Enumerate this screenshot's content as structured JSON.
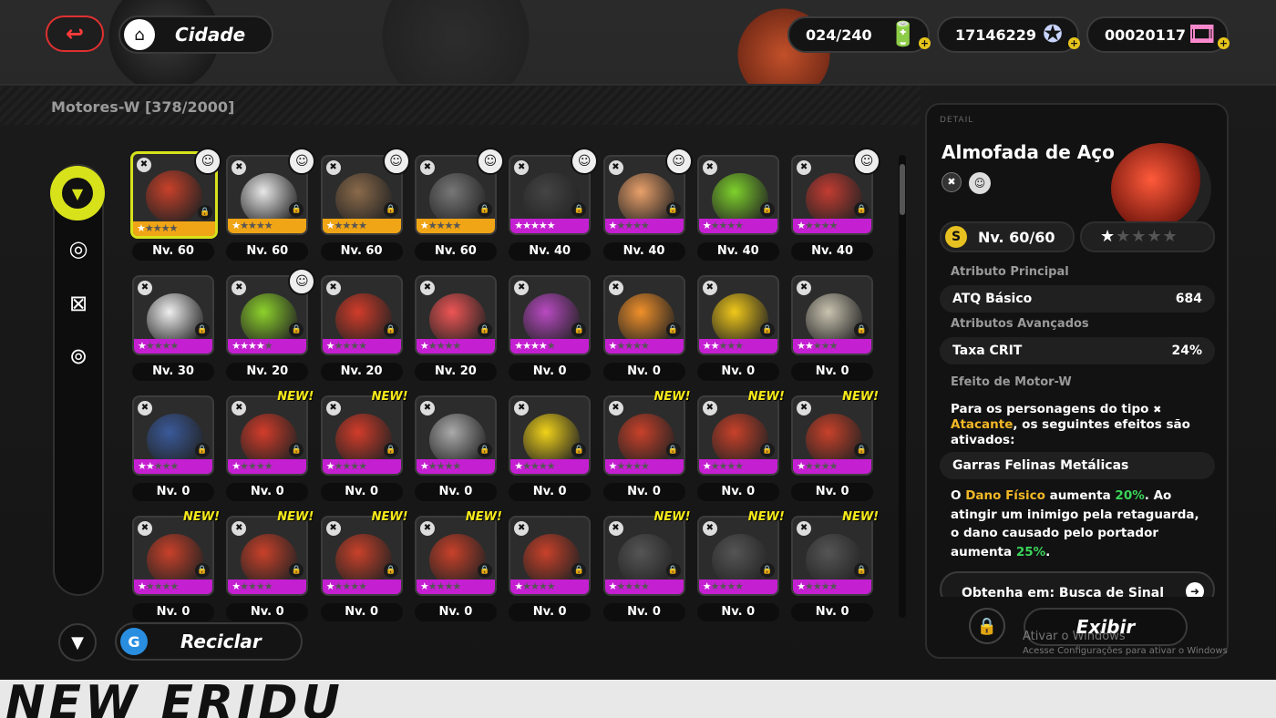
{
  "header": {
    "back_icon": "back-arrow-icon",
    "city_label": "Cidade",
    "currencies": [
      {
        "value": "024/240",
        "icon": "battery-icon"
      },
      {
        "value": "17146229",
        "icon": "dennies-coin-icon"
      },
      {
        "value": "00020117",
        "icon": "film-ticket-icon"
      }
    ]
  },
  "inventory": {
    "title": "Motores-W [378/2000]",
    "recycle_label": "Reciclar",
    "new_label": "NEW!",
    "items": [
      {
        "level": "Nv. 60",
        "stars": 1,
        "new": false,
        "avatar": true,
        "rarity": "S",
        "color": "#c8412a"
      },
      {
        "level": "Nv. 60",
        "stars": 1,
        "new": false,
        "avatar": true,
        "rarity": "S",
        "color": "#e7e7e7"
      },
      {
        "level": "Nv. 60",
        "stars": 1,
        "new": false,
        "avatar": true,
        "rarity": "S",
        "color": "#8a6a4a"
      },
      {
        "level": "Nv. 60",
        "stars": 1,
        "new": false,
        "avatar": true,
        "rarity": "S",
        "color": "#777"
      },
      {
        "level": "Nv. 40",
        "stars": 5,
        "new": false,
        "avatar": true,
        "rarity": "A",
        "color": "#444"
      },
      {
        "level": "Nv. 40",
        "stars": 1,
        "new": false,
        "avatar": true,
        "rarity": "A",
        "color": "#e9a06a"
      },
      {
        "level": "Nv. 40",
        "stars": 1,
        "new": false,
        "avatar": false,
        "rarity": "A",
        "color": "#7ed12c"
      },
      {
        "level": "Nv. 40",
        "stars": 1,
        "new": false,
        "avatar": true,
        "rarity": "A",
        "color": "#c23c32"
      },
      {
        "level": "Nv. 30",
        "stars": 1,
        "new": false,
        "avatar": false,
        "rarity": "A",
        "color": "#eee"
      },
      {
        "level": "Nv. 20",
        "stars": 4,
        "new": false,
        "avatar": true,
        "rarity": "A",
        "color": "#8dd22c"
      },
      {
        "level": "Nv. 20",
        "stars": 1,
        "new": false,
        "avatar": false,
        "rarity": "A",
        "color": "#d23c2a"
      },
      {
        "level": "Nv. 20",
        "stars": 1,
        "new": false,
        "avatar": false,
        "rarity": "A",
        "color": "#e55"
      },
      {
        "level": "Nv. 0",
        "stars": 4,
        "new": false,
        "avatar": false,
        "rarity": "A",
        "color": "#b84ac2"
      },
      {
        "level": "Nv. 0",
        "stars": 1,
        "new": false,
        "avatar": false,
        "rarity": "A",
        "color": "#f0902a"
      },
      {
        "level": "Nv. 0",
        "stars": 2,
        "new": false,
        "avatar": false,
        "rarity": "A",
        "color": "#f0c81a"
      },
      {
        "level": "Nv. 0",
        "stars": 2,
        "new": false,
        "avatar": false,
        "rarity": "A",
        "color": "#c9c3b0"
      },
      {
        "level": "Nv. 0",
        "stars": 2,
        "new": false,
        "avatar": false,
        "rarity": "A",
        "color": "#3a5a9a"
      },
      {
        "level": "Nv. 0",
        "stars": 1,
        "new": true,
        "avatar": false,
        "rarity": "A",
        "color": "#d23c2a"
      },
      {
        "level": "Nv. 0",
        "stars": 1,
        "new": true,
        "avatar": false,
        "rarity": "A",
        "color": "#d23c2a"
      },
      {
        "level": "Nv. 0",
        "stars": 1,
        "new": false,
        "avatar": false,
        "rarity": "A",
        "color": "#aaa"
      },
      {
        "level": "Nv. 0",
        "stars": 1,
        "new": false,
        "avatar": false,
        "rarity": "A",
        "color": "#f0d21a"
      },
      {
        "level": "Nv. 0",
        "stars": 1,
        "new": true,
        "avatar": false,
        "rarity": "A",
        "color": "#c8412a"
      },
      {
        "level": "Nv. 0",
        "stars": 1,
        "new": true,
        "avatar": false,
        "rarity": "A",
        "color": "#c8412a"
      },
      {
        "level": "Nv. 0",
        "stars": 1,
        "new": true,
        "avatar": false,
        "rarity": "A",
        "color": "#c8412a"
      },
      {
        "level": "Nv. 0",
        "stars": 1,
        "new": true,
        "avatar": false,
        "rarity": "A",
        "color": "#c8412a"
      },
      {
        "level": "Nv. 0",
        "stars": 1,
        "new": true,
        "avatar": false,
        "rarity": "A",
        "color": "#c8412a"
      },
      {
        "level": "Nv. 0",
        "stars": 1,
        "new": true,
        "avatar": false,
        "rarity": "A",
        "color": "#c8412a"
      },
      {
        "level": "Nv. 0",
        "stars": 1,
        "new": true,
        "avatar": false,
        "rarity": "A",
        "color": "#c8412a"
      },
      {
        "level": "Nv. 0",
        "stars": 1,
        "new": false,
        "avatar": false,
        "rarity": "A",
        "color": "#c8412a"
      },
      {
        "level": "Nv. 0",
        "stars": 1,
        "new": true,
        "avatar": false,
        "rarity": "A",
        "color": "#555"
      },
      {
        "level": "Nv. 0",
        "stars": 1,
        "new": true,
        "avatar": false,
        "rarity": "A",
        "color": "#555"
      },
      {
        "level": "Nv. 0",
        "stars": 1,
        "new": true,
        "avatar": false,
        "rarity": "A",
        "color": "#555"
      }
    ]
  },
  "detail": {
    "header": "DETAIL",
    "name": "Almofada de Aço",
    "level": "Nv. 60/60",
    "level_coin": "S",
    "stars": "★★★★★",
    "main_attr_title": "Atributo Principal",
    "main_attr": {
      "name": "ATQ Básico",
      "value": "684"
    },
    "adv_attr_title": "Atributos Avançados",
    "adv_attr": {
      "name": "Taxa CRIT",
      "value": "24%"
    },
    "effect_title": "Efeito de Motor-W",
    "effect_intro_1": "Para os personagens do tipo",
    "effect_intro_type": "Atacante",
    "effect_intro_2": ", os seguintes efeitos são ativados:",
    "set_name": "Garras Felinas Metálicas",
    "effect_text_1": "O ",
    "effect_highlight_1": "Dano Físico",
    "effect_text_2": " aumenta ",
    "effect_value_1": "20%",
    "effect_text_3": ". Ao atingir um inimigo pela retaguarda, o dano causado pelo portador aumenta ",
    "effect_value_2": "25%",
    "effect_text_4": ".",
    "obtain": "Obtenha em: Busca de Sinal",
    "show_button": "Exibir"
  },
  "watermark": {
    "line1": "Ativar o Windows",
    "line2": "Acesse Configurações para ativar o Windows"
  },
  "colors": {
    "accent": "#d7e21b",
    "s_rank": "#f0a516",
    "a_rank": "#c51fd2"
  }
}
